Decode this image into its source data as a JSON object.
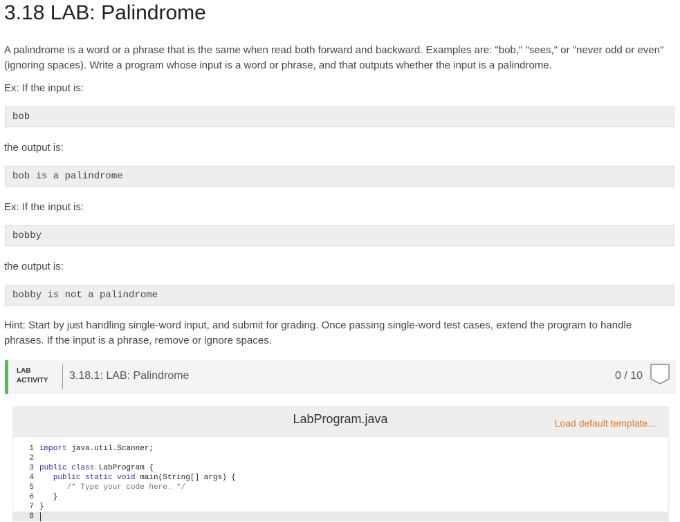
{
  "page": {
    "title": "3.18 LAB: Palindrome",
    "description": "A palindrome is a word or a phrase that is the same when read both forward and backward. Examples are: \"bob,\" \"sees,\" or \"never odd or even\" (ignoring spaces). Write a program whose input is a word or phrase, and that outputs whether the input is a palindrome.",
    "ex1_label": "Ex: If the input is:",
    "ex1_input": "bob",
    "ex1_output_label": "the output is:",
    "ex1_output": "bob is a palindrome",
    "ex2_label": "Ex: If the input is:",
    "ex2_input": "bobby",
    "ex2_output_label": "the output is:",
    "ex2_output": "bobby is not a palindrome",
    "hint": "Hint: Start by just handling single-word input, and submit for grading. Once passing single-word test cases, extend the program to handle phrases. If the input is a phrase, remove or ignore spaces."
  },
  "lab": {
    "tag_line1": "LAB",
    "tag_line2": "ACTIVITY",
    "title": "3.18.1: LAB: Palindrome",
    "score": "0 / 10",
    "accent_color": "#5cb85c"
  },
  "editor": {
    "file_name": "LabProgram.java",
    "load_template": "Load default template...",
    "line_numbers": [
      "1",
      "2",
      "3",
      "4",
      "5",
      "6",
      "7",
      "8"
    ],
    "code": {
      "l1_kw": "import",
      "l1_rest": " java.util.Scanner;",
      "l3_kw": "public class",
      "l3_rest": " LabProgram {",
      "l4_indent": "   ",
      "l4_kw": "public static void",
      "l4_rest": " main(String[] args) {",
      "l5_indent": "      ",
      "l5_comment": "/* Type your code here. */",
      "l6": "   }",
      "l7": "}"
    }
  }
}
